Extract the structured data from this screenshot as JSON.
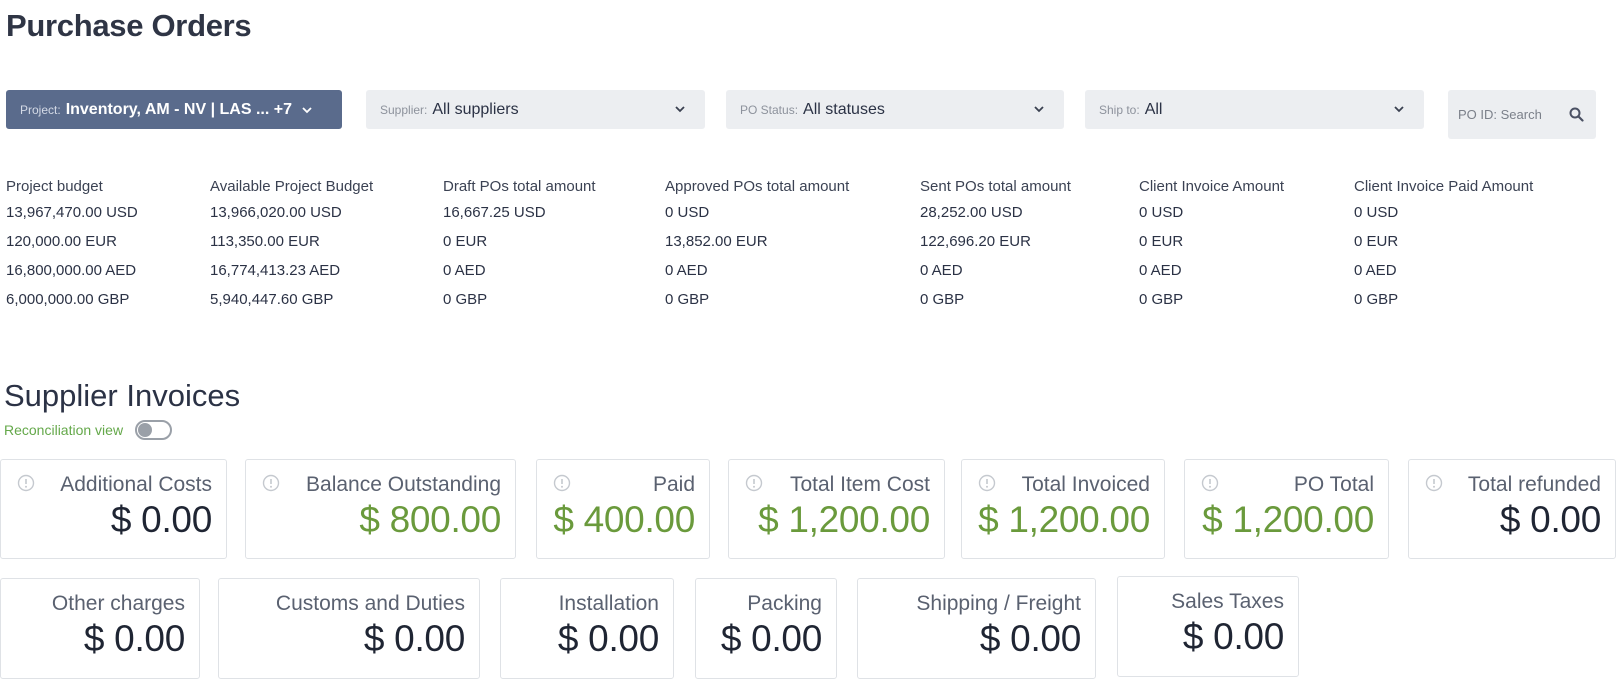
{
  "page_title": "Purchase Orders",
  "filters": {
    "project": {
      "label": "Project:",
      "value": "Inventory, AM - NV | LAS ... +7"
    },
    "supplier": {
      "label": "Supplier:",
      "value": "All suppliers"
    },
    "po_status": {
      "label": "PO Status:",
      "value": "All statuses"
    },
    "ship_to": {
      "label": "Ship to:",
      "value": "All"
    },
    "po_id_search": {
      "placeholder": "PO ID: Search"
    }
  },
  "budget_columns": [
    {
      "header": "Project budget",
      "values": [
        "13,967,470.00 USD",
        "120,000.00 EUR",
        "16,800,000.00 AED",
        "6,000,000.00 GBP"
      ]
    },
    {
      "header": "Available Project Budget",
      "values": [
        "13,966,020.00 USD",
        "113,350.00 EUR",
        "16,774,413.23 AED",
        "5,940,447.60 GBP"
      ]
    },
    {
      "header": "Draft POs total amount",
      "values": [
        "16,667.25 USD",
        "0 EUR",
        "0 AED",
        "0 GBP"
      ]
    },
    {
      "header": "Approved POs total amount",
      "values": [
        "0 USD",
        "13,852.00 EUR",
        "0 AED",
        "0 GBP"
      ]
    },
    {
      "header": "Sent POs total amount",
      "values": [
        "28,252.00 USD",
        "122,696.20 EUR",
        "0 AED",
        "0 GBP"
      ]
    },
    {
      "header": "Client Invoice Amount",
      "values": [
        "0 USD",
        "0 EUR",
        "0 AED",
        "0 GBP"
      ]
    },
    {
      "header": "Client Invoice Paid Amount",
      "values": [
        "0 USD",
        "0 EUR",
        "0 AED",
        "0 GBP"
      ]
    }
  ],
  "supplier_invoices": {
    "title": "Supplier Invoices",
    "reconciliation_label": "Reconciliation view",
    "reconciliation_on": false,
    "cards_row1": [
      {
        "label": "Additional Costs",
        "value": "$ 0.00",
        "color": "dark"
      },
      {
        "label": "Balance Outstanding",
        "value": "$ 800.00",
        "color": "green"
      },
      {
        "label": "Paid",
        "value": "$ 400.00",
        "color": "green"
      },
      {
        "label": "Total Item Cost",
        "value": "$ 1,200.00",
        "color": "green"
      },
      {
        "label": "Total Invoiced",
        "value": "$ 1,200.00",
        "color": "green"
      },
      {
        "label": "PO Total",
        "value": "$ 1,200.00",
        "color": "green"
      },
      {
        "label": "Total refunded",
        "value": "$ 0.00",
        "color": "dark"
      }
    ],
    "cards_row2": [
      {
        "label": "Other charges",
        "value": "$ 0.00"
      },
      {
        "label": "Customs and Duties",
        "value": "$ 0.00"
      },
      {
        "label": "Installation",
        "value": "$ 0.00"
      },
      {
        "label": "Packing",
        "value": "$ 0.00"
      },
      {
        "label": "Shipping / Freight",
        "value": "$ 0.00"
      },
      {
        "label": "Sales Taxes",
        "value": "$ 0.00"
      }
    ]
  },
  "colors": {
    "accent_green": "#6a9a3c",
    "project_filter_bg": "#5a6b8c",
    "filter_bg": "#eceef1"
  },
  "icons": {
    "chevron": "chevron-down-icon",
    "search": "search-icon",
    "info": "info-circle-icon"
  }
}
